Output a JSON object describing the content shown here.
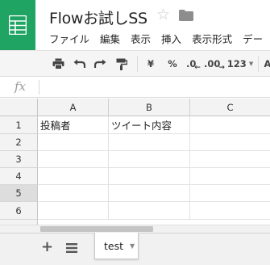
{
  "doc": {
    "title": "Flowお試しSS",
    "star_icon": "☆",
    "folder_icon": "folder-icon"
  },
  "menu": [
    "ファイル",
    "編集",
    "表示",
    "挿入",
    "表示形式",
    "デー"
  ],
  "toolbar": {
    "currency": "¥",
    "percent": "%",
    "decrease_decimal": ".0",
    "increase_decimal": ".00",
    "more_formats": "123"
  },
  "formula": {
    "fx_label": "fx",
    "value": ""
  },
  "grid": {
    "columns": [
      "A",
      "B",
      "C"
    ],
    "rows": [
      "1",
      "2",
      "3",
      "4",
      "5",
      "6"
    ],
    "selected_row": "5",
    "cells": [
      [
        "投稿者",
        "ツイート内容",
        ""
      ],
      [
        "",
        "",
        ""
      ],
      [
        "",
        "",
        ""
      ],
      [
        "",
        "",
        ""
      ],
      [
        "",
        "",
        ""
      ],
      [
        "",
        "",
        ""
      ]
    ]
  },
  "sheets": {
    "add_label": "+",
    "tabs": [
      {
        "label": "test",
        "arrow": "▼"
      }
    ]
  },
  "colors": {
    "brand_green": "#1fa463",
    "toolbar_bg": "#f5f5f5",
    "header_bg": "#f3f3f3"
  }
}
